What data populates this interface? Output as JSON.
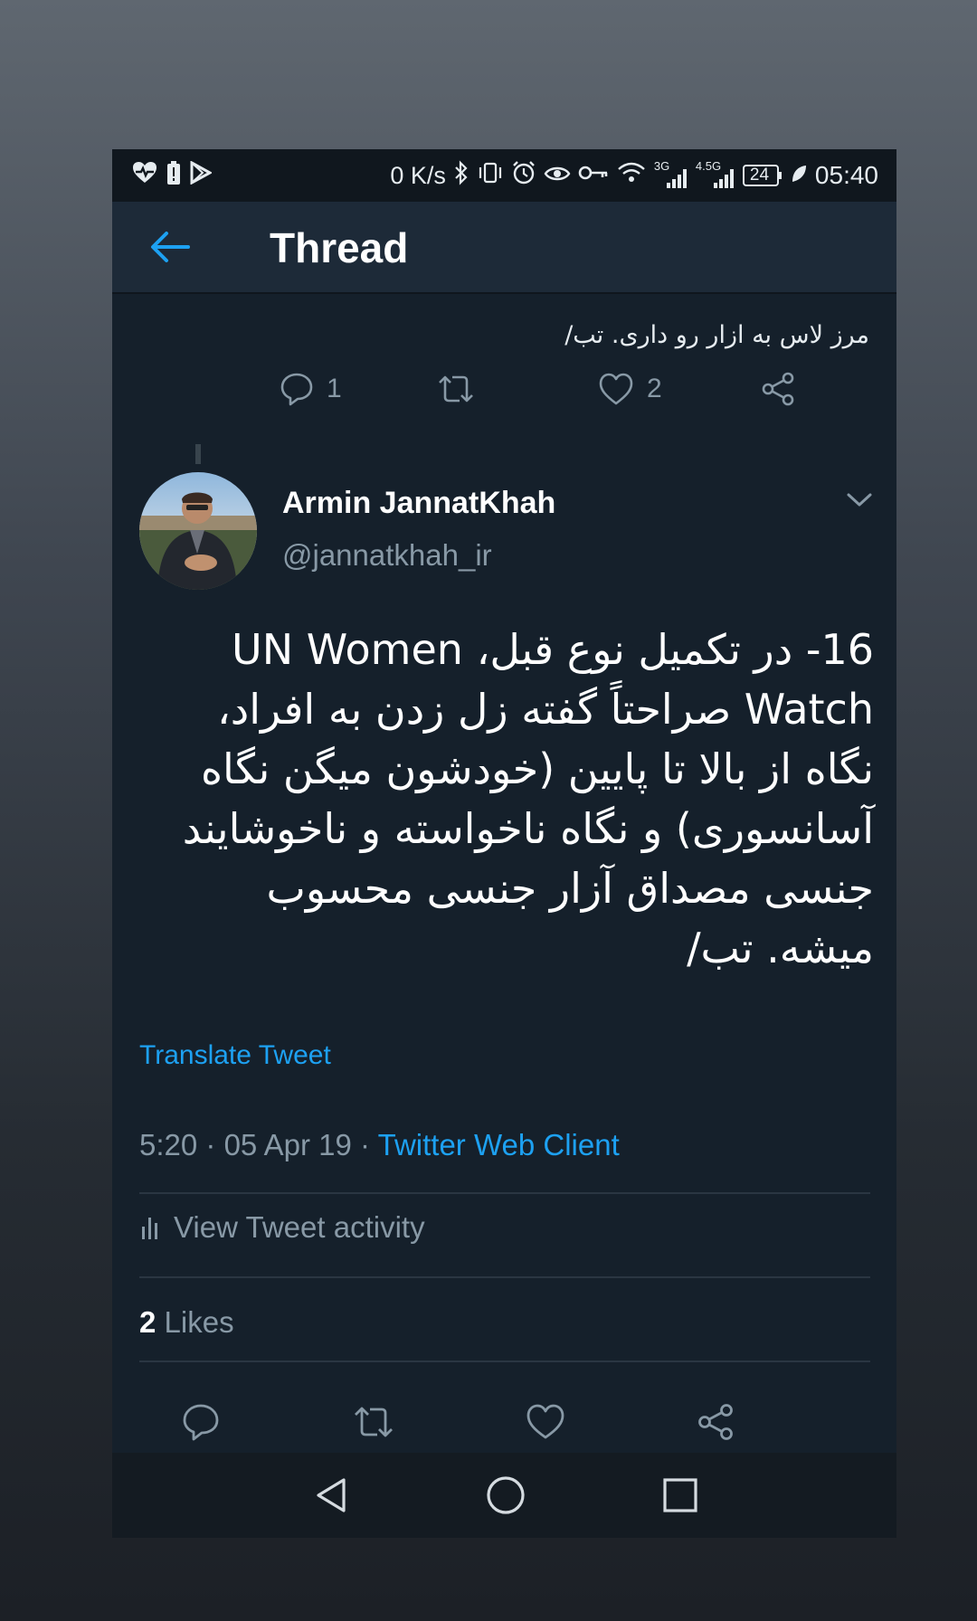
{
  "status_bar": {
    "net_speed": "0 K/s",
    "signal1_label": "3G",
    "signal2_label": "4.5G",
    "battery": "24",
    "time": "05:40"
  },
  "app_bar": {
    "title": "Thread"
  },
  "previous_tweet": {
    "text": "مرز لاس به ازار رو داری. تب/",
    "reply_count": "1",
    "like_count": "2"
  },
  "tweet": {
    "author_name": "Armin JannatKhah",
    "author_handle": "@jannatkhah_ir",
    "text": "16- در تکمیل نوع قبل، UN Women Watch صراحتاً گفته زل زدن به افراد، نگاه از بالا تا پایین (خودشون میگن نگاه آسانسوری) و نگاه ناخواسته و ناخوشایند جنسی مصداق آزار جنسی محسوب میشه. تب/",
    "translate_label": "Translate Tweet",
    "time": "5:20",
    "date": "05 Apr 19",
    "separator": "·",
    "client": "Twitter Web Client",
    "activity_label": "View Tweet activity",
    "likes_count": "2",
    "likes_label": "Likes"
  },
  "colors": {
    "background": "#15202b",
    "accent": "#1da1f2",
    "secondary_text": "#8899a6"
  },
  "icons": [
    "heart-pulse-icon",
    "battery-alert-icon",
    "play-store-icon",
    "back-arrow-icon",
    "reply-icon",
    "retweet-icon",
    "like-icon",
    "share-icon",
    "chevron-down-icon",
    "bar-chart-icon",
    "nav-back-icon",
    "nav-home-icon",
    "nav-recents-icon"
  ]
}
